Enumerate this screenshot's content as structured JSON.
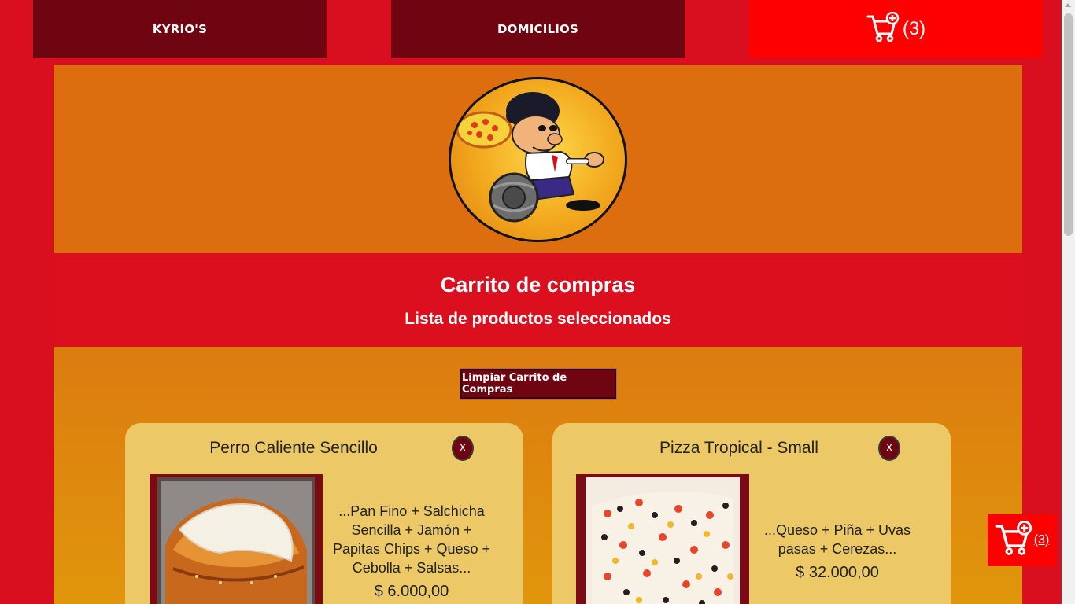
{
  "nav": {
    "brand_label": "KYRIO'S",
    "delivery_label": "DOMICILIOS",
    "cart_count": "(3)"
  },
  "header": {
    "title": "Carrito de compras",
    "subtitle": "Lista de productos seleccionados"
  },
  "actions": {
    "clear_cart_label": "Limpiar Carrito de Compras"
  },
  "cart_items": [
    {
      "name": "Perro Caliente Sencillo",
      "description": "...Pan Fino + Salchicha Sencilla + Jamón + Papitas Chips + Queso + Cebolla + Salsas...",
      "price": "$ 6.000,00",
      "remove_label": "X"
    },
    {
      "name": "Pizza Tropical - Small",
      "description": "...Queso + Piña + Uvas pasas + Cerezas...",
      "price": "$ 32.000,00",
      "remove_label": "X"
    }
  ],
  "floating_cart": {
    "count": "(3)"
  },
  "colors": {
    "page_bg": "#d90f1f",
    "nav_dark": "#6e0510",
    "cart_red": "#ff0000",
    "banner_orange": "#dc6e10",
    "card_bg": "#ecc966"
  }
}
